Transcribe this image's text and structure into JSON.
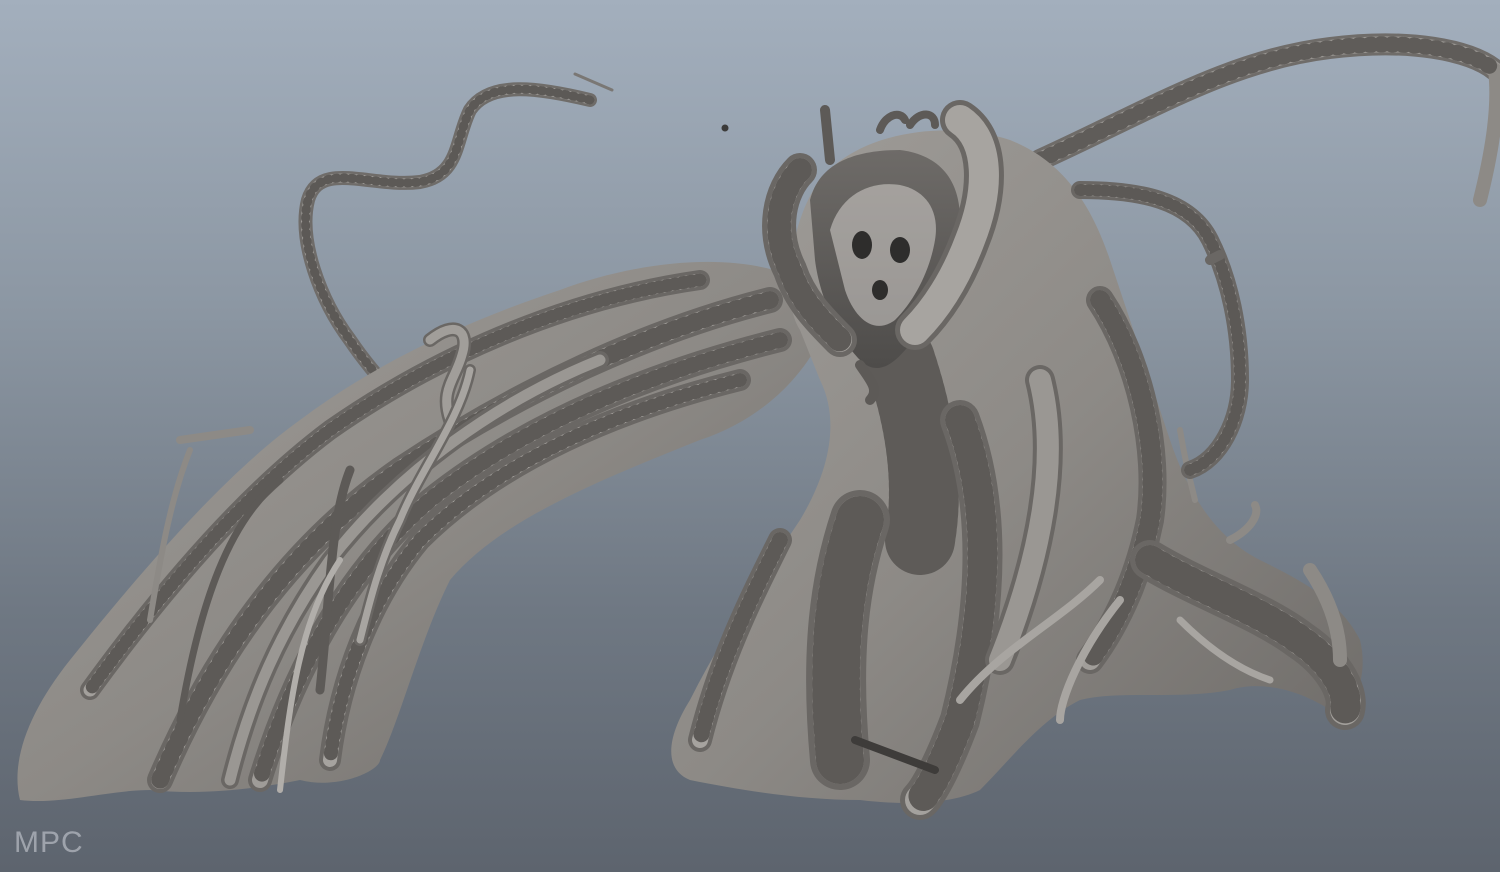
{
  "viewport": {
    "background_top": "#a3afbd",
    "background_bottom": "#5d646e",
    "mesh_color": "#8e8b88"
  },
  "watermark": {
    "text": "MPC"
  }
}
